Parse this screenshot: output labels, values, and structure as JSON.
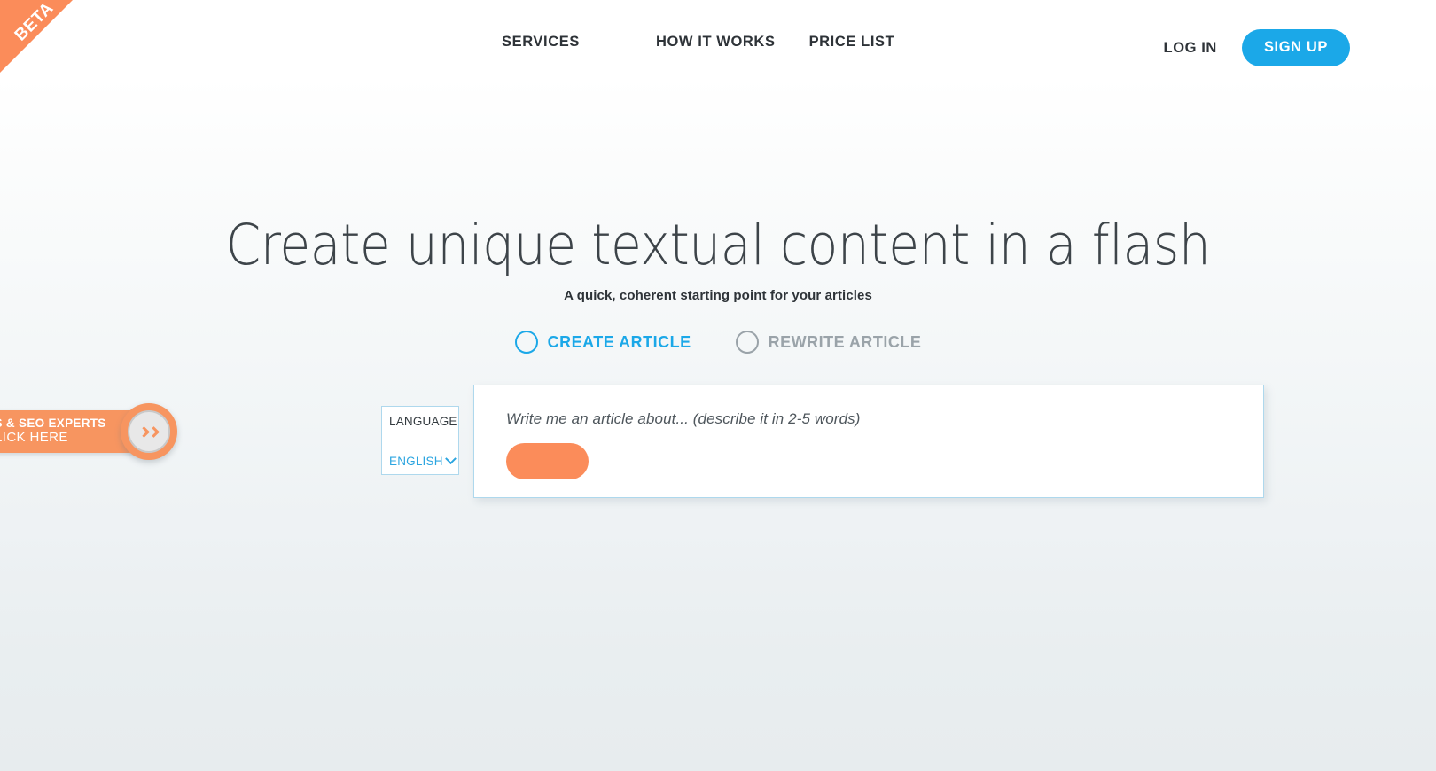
{
  "ribbon": {
    "label": "BETA"
  },
  "nav": {
    "links": [
      {
        "label": "SERVICES",
        "name": "nav-link-services"
      },
      {
        "label": "HOW IT WORKS",
        "name": "nav-link-how-it-works"
      },
      {
        "label": "PRICE LIST",
        "name": "nav-link-price-list"
      }
    ],
    "login_label": "LOG IN",
    "signup_label": "SIGN UP"
  },
  "hero": {
    "title": "Create unique textual content in a flash",
    "subtitle": "A quick, coherent starting point for your articles"
  },
  "modes": [
    {
      "label": "CREATE ARTICLE",
      "selected": true
    },
    {
      "label": "REWRITE ARTICLE",
      "selected": false
    }
  ],
  "language": {
    "label": "LANGUAGE",
    "value": "ENGLISH"
  },
  "prompt": {
    "placeholder": "Write me an article about... (describe it in 2-5 words)",
    "value": "",
    "submit_label": ""
  },
  "promo": {
    "line1": "GENCIES & SEO EXPERTS",
    "line2": "CLICK HERE"
  },
  "colors": {
    "accent_blue": "#1BA8E8",
    "accent_orange": "#FB8C5A",
    "promo_orange": "#F79560",
    "muted_gray": "#9aa3a9",
    "text_dark": "#2e3338",
    "panel_border": "#aed8ed"
  }
}
